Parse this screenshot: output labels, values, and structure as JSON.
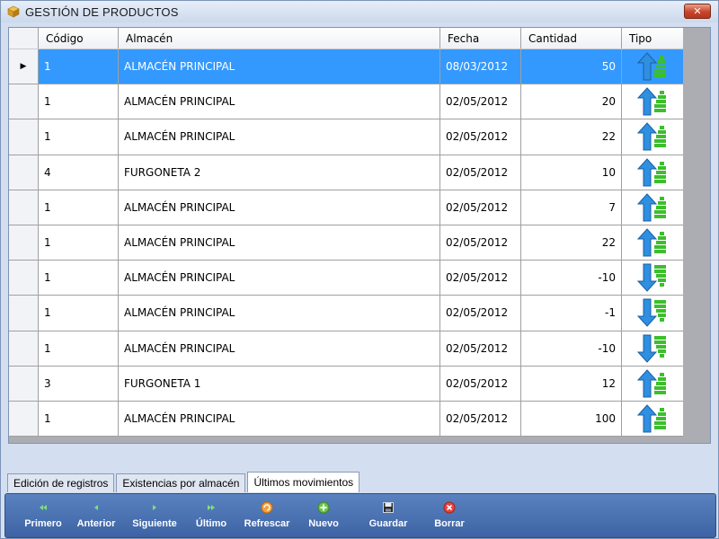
{
  "window": {
    "title": "GESTIÓN DE PRODUCTOS",
    "close_label": "✕"
  },
  "grid": {
    "columns": {
      "codigo": "Código",
      "almacen": "Almacén",
      "fecha": "Fecha",
      "cantidad": "Cantidad",
      "tipo": "Tipo"
    },
    "rows": [
      {
        "codigo": "1",
        "almacen": "ALMACÉN PRINCIPAL",
        "fecha": "08/03/2012",
        "cantidad": "50",
        "tipo": "entrada"
      },
      {
        "codigo": "1",
        "almacen": "ALMACÉN PRINCIPAL",
        "fecha": "02/05/2012",
        "cantidad": "20",
        "tipo": "entrada"
      },
      {
        "codigo": "1",
        "almacen": "ALMACÉN PRINCIPAL",
        "fecha": "02/05/2012",
        "cantidad": "22",
        "tipo": "entrada"
      },
      {
        "codigo": "4",
        "almacen": "FURGONETA 2",
        "fecha": "02/05/2012",
        "cantidad": "10",
        "tipo": "entrada"
      },
      {
        "codigo": "1",
        "almacen": "ALMACÉN PRINCIPAL",
        "fecha": "02/05/2012",
        "cantidad": "7",
        "tipo": "entrada"
      },
      {
        "codigo": "1",
        "almacen": "ALMACÉN PRINCIPAL",
        "fecha": "02/05/2012",
        "cantidad": "22",
        "tipo": "entrada"
      },
      {
        "codigo": "1",
        "almacen": "ALMACÉN PRINCIPAL",
        "fecha": "02/05/2012",
        "cantidad": "-10",
        "tipo": "salida"
      },
      {
        "codigo": "1",
        "almacen": "ALMACÉN PRINCIPAL",
        "fecha": "02/05/2012",
        "cantidad": "-1",
        "tipo": "salida"
      },
      {
        "codigo": "1",
        "almacen": "ALMACÉN PRINCIPAL",
        "fecha": "02/05/2012",
        "cantidad": "-10",
        "tipo": "salida"
      },
      {
        "codigo": "3",
        "almacen": "FURGONETA 1",
        "fecha": "02/05/2012",
        "cantidad": "12",
        "tipo": "entrada"
      },
      {
        "codigo": "1",
        "almacen": "ALMACÉN PRINCIPAL",
        "fecha": "02/05/2012",
        "cantidad": "100",
        "tipo": "entrada"
      }
    ],
    "selected_row_index": 0
  },
  "tabs": [
    {
      "label": "Edición de registros",
      "active": false
    },
    {
      "label": "Existencias por almacén",
      "active": false
    },
    {
      "label": "Últimos movimientos",
      "active": true
    }
  ],
  "toolbar": {
    "buttons": [
      {
        "id": "primero",
        "label": "Primero",
        "icon": "first-icon"
      },
      {
        "id": "anterior",
        "label": "Anterior",
        "icon": "previous-icon"
      },
      {
        "id": "siguiente",
        "label": "Siguiente",
        "icon": "next-icon"
      },
      {
        "id": "ultimo",
        "label": "Último",
        "icon": "last-icon"
      },
      {
        "id": "refrescar",
        "label": "Refrescar",
        "icon": "refresh-icon"
      },
      {
        "id": "nuevo",
        "label": "Nuevo",
        "icon": "add-icon"
      },
      {
        "id": "guardar",
        "label": "Guardar",
        "icon": "save-icon"
      },
      {
        "id": "borrar",
        "label": "Borrar",
        "icon": "delete-icon"
      }
    ]
  },
  "colors": {
    "selection": "#3399ff",
    "arrow_up": "#2f8fe0",
    "arrow_down": "#2f8fe0",
    "bars_green": "#3cbf2c",
    "toolbar": "#4a72b3"
  }
}
